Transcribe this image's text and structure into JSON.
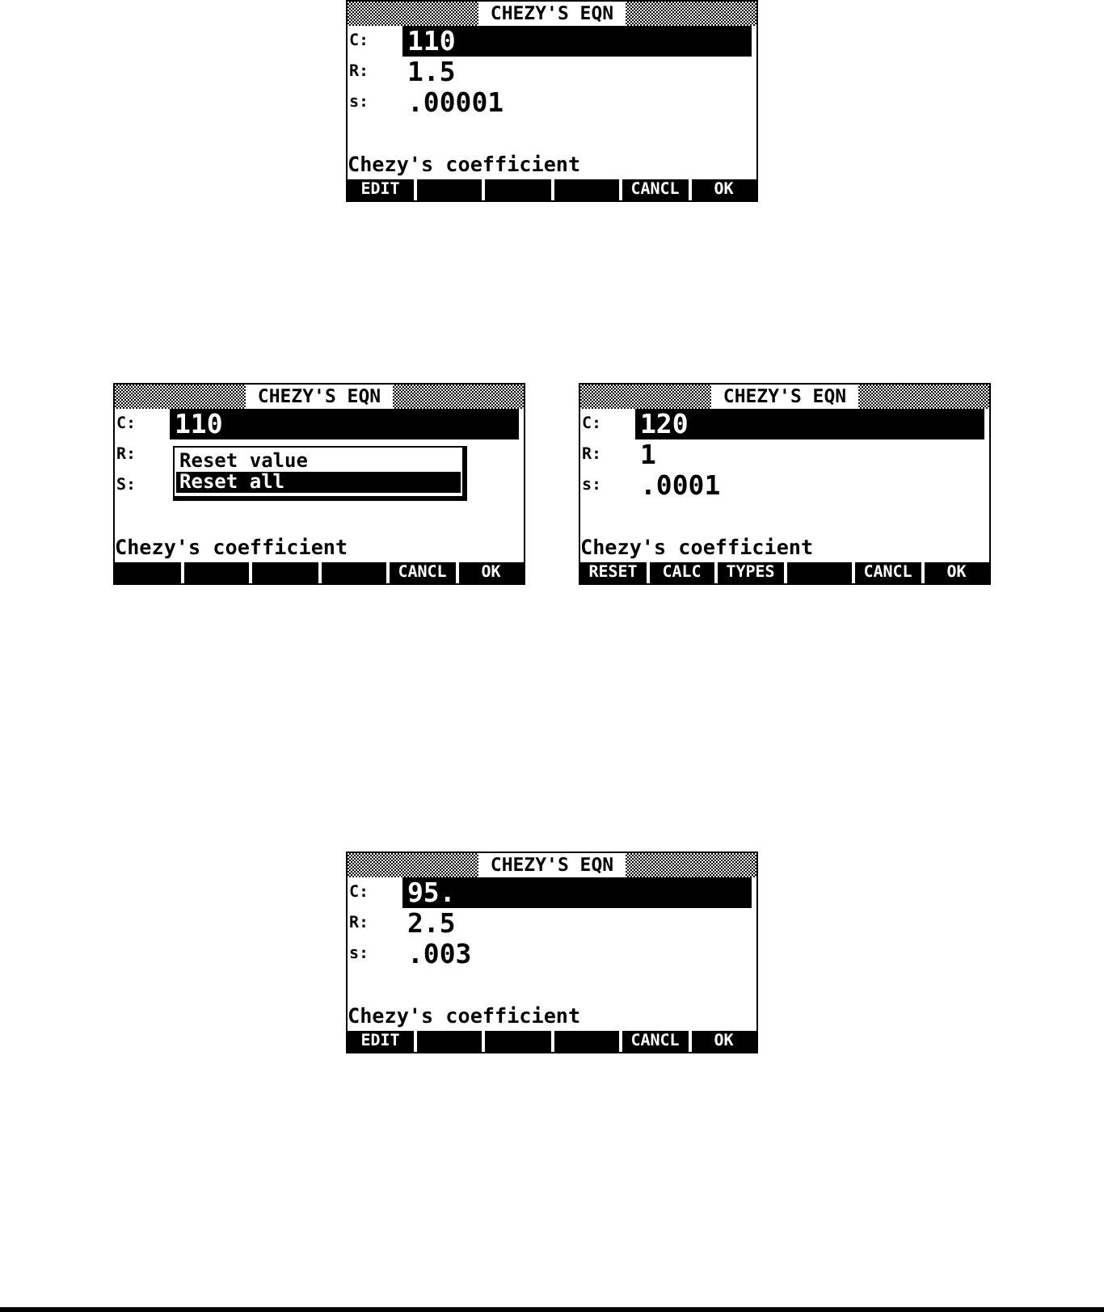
{
  "rows": [
    {
      "screens": [
        {
          "title": "CHEZY'S EQN",
          "fields": [
            {
              "label": "C:",
              "value": "110",
              "selected": true
            },
            {
              "label": "R:",
              "value": "1.5",
              "selected": false
            },
            {
              "label": "s:",
              "value": ".00001",
              "selected": false
            }
          ],
          "help": "Chezy's coefficient",
          "softkeys": [
            {
              "kind": "label",
              "label": "EDIT"
            },
            {
              "kind": "blank"
            },
            {
              "kind": "blank"
            },
            {
              "kind": "blank"
            },
            {
              "kind": "label",
              "label": "CANCL"
            },
            {
              "kind": "label",
              "label": "OK"
            }
          ]
        }
      ]
    },
    {
      "screens": [
        {
          "title": "CHEZY'S EQN",
          "fields": [
            {
              "label": "C:",
              "value": "110",
              "selected": true
            },
            {
              "label": "R:",
              "selected": false
            },
            {
              "label": "S:",
              "selected": false
            }
          ],
          "popup": {
            "items": [
              {
                "label": "Reset value",
                "selected": false
              },
              {
                "label": "Reset all",
                "selected": true
              }
            ]
          },
          "help": "Chezy's coefficient",
          "softkeys": [
            {
              "kind": "blank"
            },
            {
              "kind": "blank"
            },
            {
              "kind": "blank"
            },
            {
              "kind": "blank"
            },
            {
              "kind": "label",
              "label": "CANCL"
            },
            {
              "kind": "label",
              "label": "OK"
            }
          ]
        },
        {
          "title": "CHEZY'S EQN",
          "fields": [
            {
              "label": "C:",
              "value": "120",
              "selected": true
            },
            {
              "label": "R:",
              "value": "1",
              "selected": false
            },
            {
              "label": "s:",
              "value": ".0001",
              "selected": false
            }
          ],
          "help": "Chezy's coefficient",
          "softkeys": [
            {
              "kind": "label",
              "label": "RESET"
            },
            {
              "kind": "label",
              "label": "CALC"
            },
            {
              "kind": "label",
              "label": "TYPES"
            },
            {
              "kind": "blank"
            },
            {
              "kind": "label",
              "label": "CANCL"
            },
            {
              "kind": "label",
              "label": "OK"
            }
          ]
        }
      ]
    },
    {
      "screens": [
        {
          "title": "CHEZY'S EQN",
          "fields": [
            {
              "label": "C:",
              "value": "95.",
              "selected": true
            },
            {
              "label": "R:",
              "value": "2.5",
              "selected": false
            },
            {
              "label": "s:",
              "value": ".003",
              "selected": false
            }
          ],
          "help": "Chezy's coefficient",
          "softkeys": [
            {
              "kind": "label",
              "label": "EDIT"
            },
            {
              "kind": "blank"
            },
            {
              "kind": "blank"
            },
            {
              "kind": "blank"
            },
            {
              "kind": "label",
              "label": "CANCL"
            },
            {
              "kind": "label",
              "label": "OK"
            }
          ]
        }
      ]
    }
  ]
}
